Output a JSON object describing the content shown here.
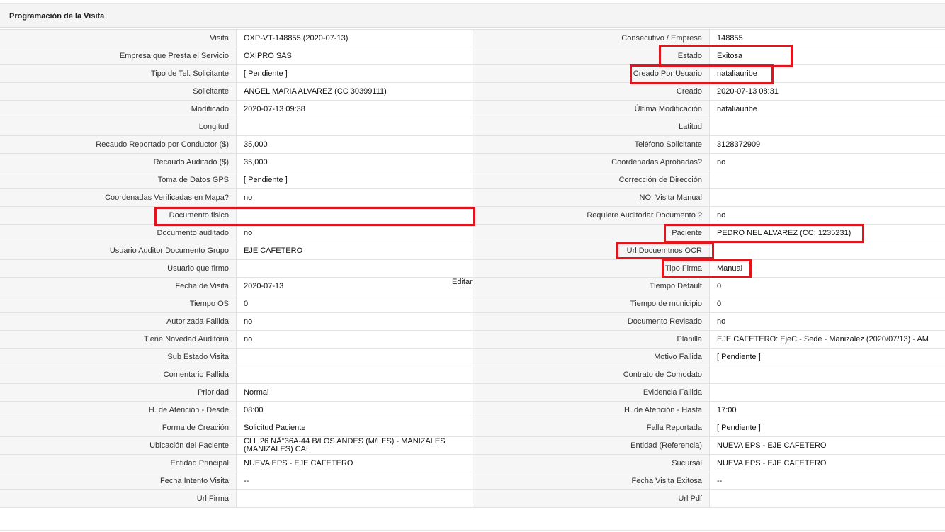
{
  "panel": {
    "title": "Programación de la Visita"
  },
  "edit_label": "Editar",
  "rows": [
    {
      "l1": "Visita",
      "v1": "OXP-VT-148855 (2020-07-13)",
      "l2": "Consecutivo / Empresa",
      "v2": "148855"
    },
    {
      "l1": "Empresa que Presta el Servicio",
      "v1": "OXIPRO SAS",
      "l2": "Estado",
      "v2": "Exitosa"
    },
    {
      "l1": "Tipo de Tel. Solicitante",
      "v1": "[ Pendiente ]",
      "l2": "Creado Por Usuario",
      "v2": "nataliauribe"
    },
    {
      "l1": "Solicitante",
      "v1": "ANGEL MARIA ALVAREZ (CC 30399111)",
      "l2": "Creado",
      "v2": "2020-07-13 08:31"
    },
    {
      "l1": "Modificado",
      "v1": "2020-07-13 09:38",
      "l2": "Última Modificación",
      "v2": " nataliauribe"
    },
    {
      "l1": "Longitud",
      "v1": "",
      "l2": "Latitud",
      "v2": ""
    },
    {
      "l1": "Recaudo Reportado por Conductor ($)",
      "v1": "35,000",
      "l2": "Teléfono Solicitante",
      "v2": "3128372909"
    },
    {
      "l1": "Recaudo Auditado ($)",
      "v1": "35,000",
      "l2": "Coordenadas Aprobadas?",
      "v2": " no"
    },
    {
      "l1": "Toma de Datos GPS",
      "v1": "[ Pendiente ]",
      "l2": "Corrección de Dirección",
      "v2": ""
    },
    {
      "l1": "Coordenadas Verificadas en Mapa?",
      "v1": " no",
      "l2": "NO. Visita Manual",
      "v2": ""
    },
    {
      "l1": "Documento fisico",
      "v1": "",
      "l2": "Requiere Auditoriar Documento ?",
      "v2": " no"
    },
    {
      "l1": "Documento auditado",
      "v1": " no",
      "l2": "Paciente",
      "v2": "PEDRO NEL ALVAREZ (CC: 1235231)"
    },
    {
      "l1": "Usuario Auditor Documento Grupo",
      "v1": "EJE CAFETERO",
      "l2": "Url Docuemtnos OCR",
      "v2": ""
    },
    {
      "l1": "Usuario que firmo",
      "v1": "",
      "l2": "Tipo Firma",
      "v2": "Manual"
    },
    {
      "l1": "Fecha de Visita",
      "v1": " 2020-07-13",
      "l2": "Tiempo Default",
      "v2": "0"
    },
    {
      "l1": "Tiempo OS",
      "v1": "0",
      "l2": "Tiempo de municipio",
      "v2": "0"
    },
    {
      "l1": "Autorizada Fallida",
      "v1": " no",
      "l2": "Documento Revisado",
      "v2": " no"
    },
    {
      "l1": "Tiene Novedad Auditoria",
      "v1": " no",
      "l2": "Planilla",
      "v2": "EJE CAFETERO: EjeC - Sede - Manizalez (2020/07/13) - AM"
    },
    {
      "l1": "Sub Estado Visita",
      "v1": "",
      "l2": "Motivo Fallida",
      "v2": "[ Pendiente ]"
    },
    {
      "l1": "Comentario Fallida",
      "v1": "",
      "l2": "Contrato de Comodato",
      "v2": ""
    },
    {
      "l1": "Prioridad",
      "v1": "Normal",
      "l2": "Evidencia Fallida",
      "v2": ""
    },
    {
      "l1": "H. de Atención - Desde",
      "v1": "08:00",
      "l2": "H. de Atención - Hasta",
      "v2": "17:00"
    },
    {
      "l1": "Forma de Creación",
      "v1": "Solicitud Paciente",
      "l2": "Falla Reportada",
      "v2": "[ Pendiente ]"
    },
    {
      "l1": "Ubicación del Paciente",
      "v1": "CLL 26 NÂ°36A-44 B/LOS ANDES (M/LES) - MANIZALES (MANIZALES) CAL",
      "l2": "Entidad (Referencia)",
      "v2": "NUEVA EPS - EJE CAFETERO"
    },
    {
      "l1": "Entidad Principal",
      "v1": "NUEVA EPS - EJE CAFETERO",
      "l2": "Sucursal",
      "v2": "NUEVA EPS - EJE CAFETERO"
    },
    {
      "l1": "Fecha Intento Visita",
      "v1": " --",
      "l2": "Fecha Visita Exitosa",
      "v2": " --"
    },
    {
      "l1": "Url Firma",
      "v1": "",
      "l2": "Url Pdf",
      "v2": ""
    }
  ]
}
